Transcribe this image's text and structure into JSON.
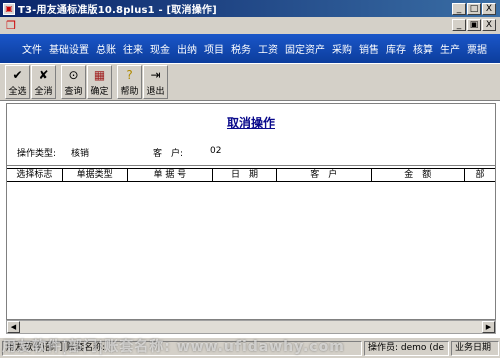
{
  "window": {
    "title": "T3-用友通标准版10.8plus1 - [取消操作]",
    "buttons": [
      "_",
      "□",
      "X"
    ]
  },
  "mdi": {
    "buttons": [
      "_",
      "▣",
      "X"
    ]
  },
  "menu": {
    "items": [
      "文件",
      "基础设置",
      "总账",
      "往来",
      "现金",
      "出纳",
      "项目",
      "税务",
      "工资",
      "固定资产",
      "采购",
      "销售",
      "库存",
      "核算",
      "生产",
      "票据"
    ]
  },
  "toolbar": {
    "buttons": [
      {
        "label": "全选",
        "icon": "check-all-icon"
      },
      {
        "label": "全消",
        "icon": "uncheck-all-icon"
      },
      {
        "label": "查询",
        "icon": "binoculars-icon"
      },
      {
        "label": "确定",
        "icon": "confirm-icon"
      },
      {
        "label": "帮助",
        "icon": "help-icon"
      },
      {
        "label": "退出",
        "icon": "exit-icon"
      }
    ]
  },
  "panel": {
    "heading": "取消操作",
    "op_type_label": "操作类型:",
    "op_type_value": "核销",
    "customer_label": "客　户:",
    "customer_value": "02"
  },
  "table": {
    "columns": [
      "选择标志",
      "单据类型",
      "单 据 号",
      "日　期",
      "客　户",
      "金　额",
      "部"
    ]
  },
  "status": {
    "cell1": "用友软件|部门|账套名称:",
    "cell2": "操作员: demo (de",
    "cell3": "业务日期"
  },
  "watermark": "用友软件|部门|账套名称:  www.ufidawhy.com"
}
